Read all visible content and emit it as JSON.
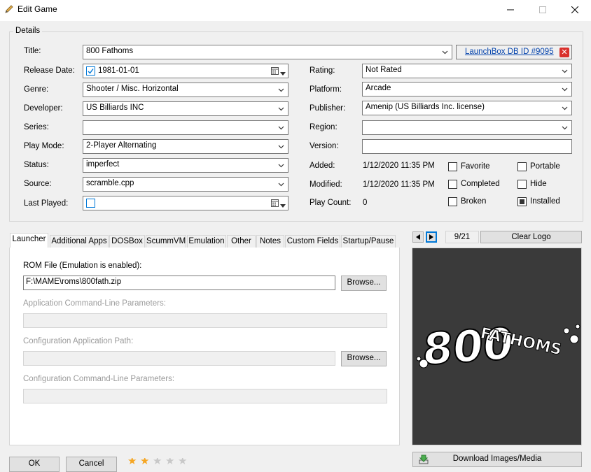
{
  "window": {
    "title": "Edit Game",
    "minimize_icon": "minimize-icon",
    "maximize_icon": "maximize-icon",
    "close_icon": "close-icon"
  },
  "details": {
    "group_label": "Details",
    "title_label": "Title:",
    "title_value": "800 Fathoms",
    "db_link": "LaunchBox DB ID #9095",
    "release_date_label": "Release Date:",
    "release_date_value": "1981-01-01",
    "genre_label": "Genre:",
    "genre_value": "Shooter / Misc. Horizontal",
    "developer_label": "Developer:",
    "developer_value": "US Billiards INC",
    "series_label": "Series:",
    "series_value": "",
    "play_mode_label": "Play Mode:",
    "play_mode_value": "2-Player Alternating",
    "status_label": "Status:",
    "status_value": "imperfect",
    "source_label": "Source:",
    "source_value": "scramble.cpp",
    "last_played_label": "Last Played:",
    "last_played_value": "",
    "rating_label": "Rating:",
    "rating_value": "Not Rated",
    "platform_label": "Platform:",
    "platform_value": "Arcade",
    "publisher_label": "Publisher:",
    "publisher_value": "Amenip (US Billiards Inc. license)",
    "region_label": "Region:",
    "region_value": "",
    "version_label": "Version:",
    "version_value": "",
    "added_label": "Added:",
    "added_value": "1/12/2020 11:35 PM",
    "modified_label": "Modified:",
    "modified_value": "1/12/2020 11:35 PM",
    "play_count_label": "Play Count:",
    "play_count_value": "0",
    "checkboxes": {
      "favorite": {
        "label": "Favorite",
        "checked": false
      },
      "portable": {
        "label": "Portable",
        "checked": false
      },
      "completed": {
        "label": "Completed",
        "checked": false
      },
      "hide": {
        "label": "Hide",
        "checked": false
      },
      "broken": {
        "label": "Broken",
        "checked": false
      },
      "installed": {
        "label": "Installed",
        "checked": true
      }
    }
  },
  "tabs": [
    "Launcher",
    "Additional Apps",
    "DOSBox",
    "ScummVM",
    "Emulation",
    "Other",
    "Notes",
    "Custom Fields",
    "Startup/Pause"
  ],
  "launcher": {
    "rom_label": "ROM File (Emulation is enabled):",
    "rom_value": "F:\\MAME\\roms\\800fath.zip",
    "browse_label": "Browse...",
    "cmd_label": "Application Command-Line Parameters:",
    "cmd_value": "",
    "config_path_label": "Configuration Application Path:",
    "config_path_value": "",
    "config_browse_label": "Browse...",
    "config_cmd_label": "Configuration Command-Line Parameters:",
    "config_cmd_value": ""
  },
  "media": {
    "counter": "9/21",
    "image_type": "Clear Logo",
    "download_label": "Download Images/Media",
    "logo_text_left": "800",
    "logo_text_right": "FATHOMS"
  },
  "footer": {
    "ok_label": "OK",
    "cancel_label": "Cancel",
    "stars_filled": 2,
    "stars_total": 5
  },
  "colors": {
    "accent": "#0078d7",
    "link": "#0645ad",
    "close_red": "#d9302c",
    "star": "#f5a623"
  }
}
